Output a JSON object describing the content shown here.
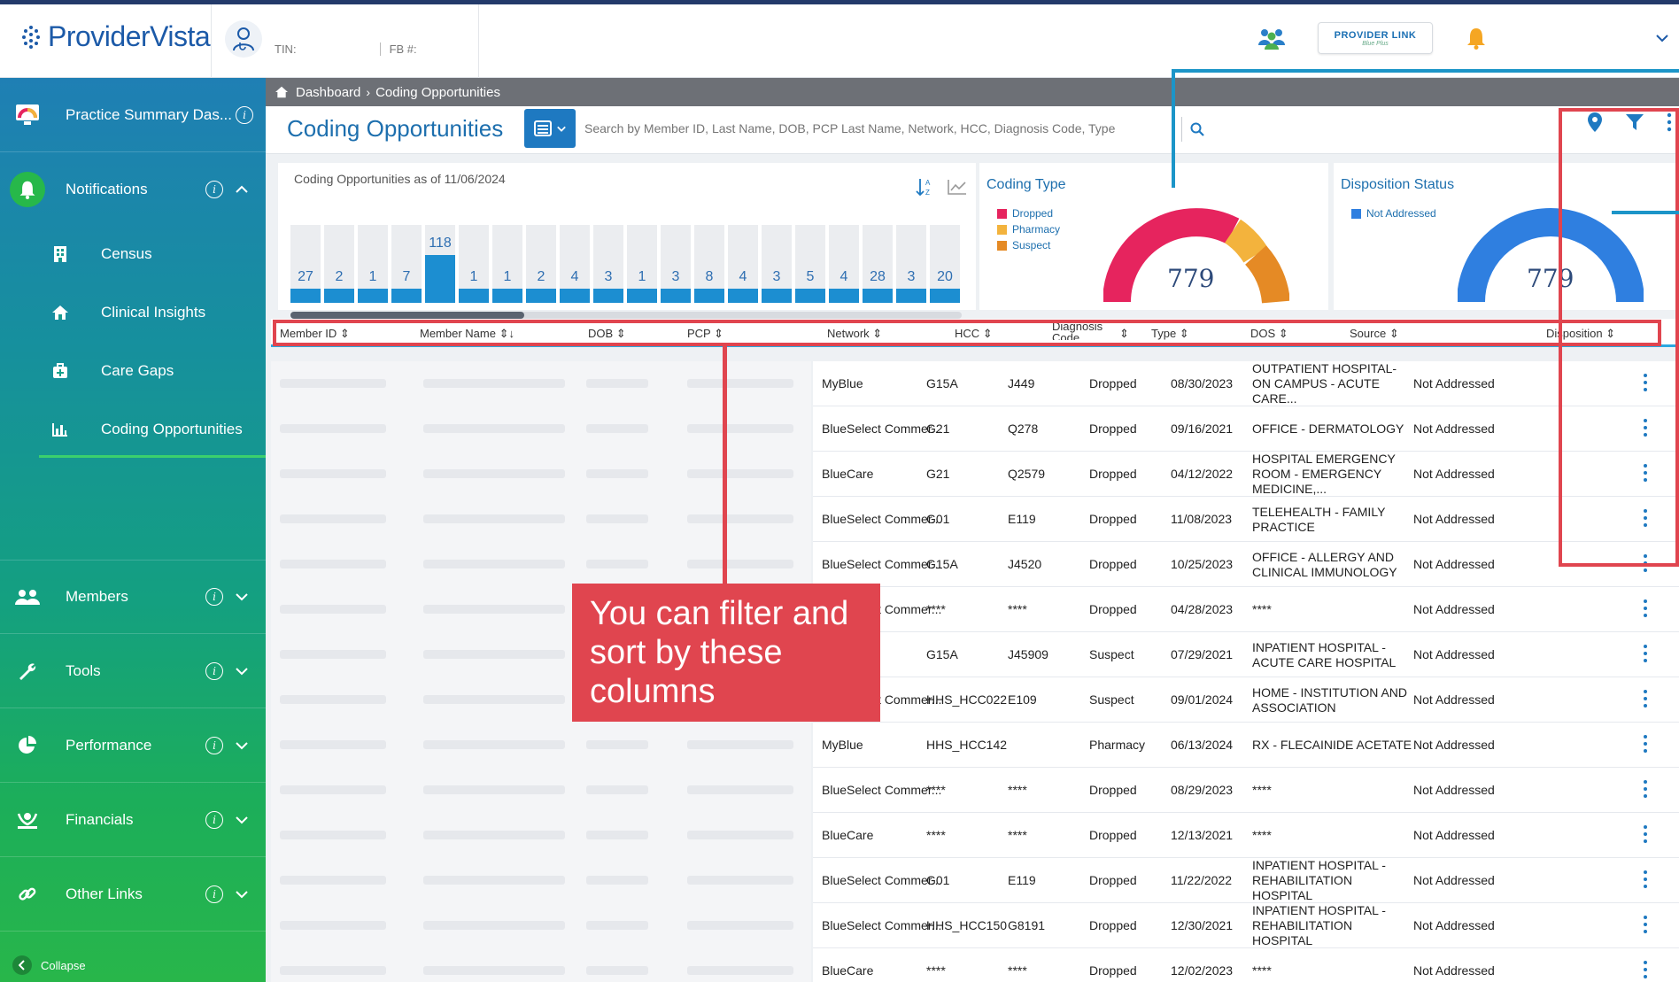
{
  "app": {
    "logo_text": "ProviderVista",
    "tin_label": "TIN:",
    "fb_label": "FB #:",
    "provider_link_label": "PROVIDER LINK",
    "provider_link_sub": "Blue Plus"
  },
  "sidebar": {
    "items": [
      {
        "label": "Practice Summary Das...",
        "icon": "dashboard-icon"
      },
      {
        "label": "Notifications",
        "icon": "bell-icon"
      },
      {
        "label": "Members",
        "icon": "members-icon"
      },
      {
        "label": "Tools",
        "icon": "wrench-icon"
      },
      {
        "label": "Performance",
        "icon": "pie-chart-icon"
      },
      {
        "label": "Financials",
        "icon": "financials-icon"
      },
      {
        "label": "Other Links",
        "icon": "link-icon"
      }
    ],
    "subitems": [
      {
        "label": "Census",
        "icon": "building-icon"
      },
      {
        "label": "Clinical Insights",
        "icon": "home-icon"
      },
      {
        "label": "Care Gaps",
        "icon": "medkit-icon"
      },
      {
        "label": "Coding Opportunities",
        "icon": "bar-chart-icon"
      }
    ],
    "collapse_label": "Collapse"
  },
  "breadcrumb": {
    "home": "Dashboard",
    "current": "Coding Opportunities"
  },
  "page": {
    "title": "Coding Opportunities",
    "search_placeholder": "Search by Member ID, Last Name, DOB, PCP Last Name, Network, HCC, Diagnosis Code, Type"
  },
  "trend": {
    "as_of": "Coding Opportunities as of 11/06/2024",
    "values": [
      27,
      2,
      1,
      7,
      118,
      1,
      1,
      2,
      4,
      3,
      1,
      3,
      8,
      4,
      3,
      5,
      4,
      28,
      3,
      20
    ],
    "highlight_index": 4
  },
  "coding_type": {
    "title": "Coding Type",
    "legend": [
      {
        "label": "Dropped",
        "color": "#e6245e"
      },
      {
        "label": "Pharmacy",
        "color": "#f3b33d"
      },
      {
        "label": "Suspect",
        "color": "#e58a25"
      }
    ],
    "total": "779"
  },
  "disposition": {
    "title": "Disposition Status",
    "legend": [
      {
        "label": "Not Addressed",
        "color": "#2f7fe0"
      }
    ],
    "total": "779"
  },
  "table": {
    "headers": [
      "Member ID",
      "Member Name",
      "DOB",
      "PCP",
      "Network",
      "HCC",
      "Diagnosis Code",
      "Type",
      "DOS",
      "Source",
      "Disposition"
    ],
    "rows": [
      {
        "network": "MyBlue",
        "hcc": "G15A",
        "dx": "J449",
        "type": "Dropped",
        "dos": "08/30/2023",
        "source": "OUTPATIENT HOSPITAL-ON CAMPUS - ACUTE CARE...",
        "disposition": "Not Addressed"
      },
      {
        "network": "BlueSelect Commer...",
        "hcc": "G21",
        "dx": "Q278",
        "type": "Dropped",
        "dos": "09/16/2021",
        "source": "OFFICE - DERMATOLOGY",
        "disposition": "Not Addressed"
      },
      {
        "network": "BlueCare",
        "hcc": "G21",
        "dx": "Q2579",
        "type": "Dropped",
        "dos": "04/12/2022",
        "source": "HOSPITAL EMERGENCY ROOM - EMERGENCY MEDICINE,...",
        "disposition": "Not Addressed"
      },
      {
        "network": "BlueSelect Commer...",
        "hcc": "G01",
        "dx": "E119",
        "type": "Dropped",
        "dos": "11/08/2023",
        "source": "TELEHEALTH - FAMILY PRACTICE",
        "disposition": "Not Addressed"
      },
      {
        "network": "BlueSelect Commer...",
        "hcc": "G15A",
        "dx": "J4520",
        "type": "Dropped",
        "dos": "10/25/2023",
        "source": "OFFICE - ALLERGY AND CLINICAL IMMUNOLOGY",
        "disposition": "Not Addressed"
      },
      {
        "network": "BlueSelect Commer...",
        "hcc": "****",
        "dx": "****",
        "type": "Dropped",
        "dos": "04/28/2023",
        "source": "****",
        "disposition": "Not Addressed"
      },
      {
        "network": "",
        "hcc": "G15A",
        "dx": "J45909",
        "type": "Suspect",
        "dos": "07/29/2021",
        "source": "INPATIENT HOSPITAL - ACUTE CARE HOSPITAL",
        "disposition": "Not Addressed"
      },
      {
        "network": "BlueSelect Commer...",
        "hcc": "HHS_HCC022",
        "dx": "E109",
        "type": "Suspect",
        "dos": "09/01/2024",
        "source": "HOME - INSTITUTION AND ASSOCIATION",
        "disposition": "Not Addressed"
      },
      {
        "network": "MyBlue",
        "hcc": "HHS_HCC142",
        "dx": "",
        "type": "Pharmacy",
        "dos": "06/13/2024",
        "source": "RX - FLECAINIDE ACETATE",
        "disposition": "Not Addressed"
      },
      {
        "network": "BlueSelect Commer...",
        "hcc": "****",
        "dx": "****",
        "type": "Dropped",
        "dos": "08/29/2023",
        "source": "****",
        "disposition": "Not Addressed"
      },
      {
        "network": "BlueCare",
        "hcc": "****",
        "dx": "****",
        "type": "Dropped",
        "dos": "12/13/2021",
        "source": "****",
        "disposition": "Not Addressed"
      },
      {
        "network": "BlueSelect Commer...",
        "hcc": "G01",
        "dx": "E119",
        "type": "Dropped",
        "dos": "11/22/2022",
        "source": "INPATIENT HOSPITAL - REHABILITATION HOSPITAL",
        "disposition": "Not Addressed"
      },
      {
        "network": "BlueSelect Commer...",
        "hcc": "HHS_HCC150",
        "dx": "G8191",
        "type": "Dropped",
        "dos": "12/30/2021",
        "source": "INPATIENT HOSPITAL - REHABILITATION HOSPITAL",
        "disposition": "Not Addressed"
      },
      {
        "network": "BlueCare",
        "hcc": "****",
        "dx": "****",
        "type": "Dropped",
        "dos": "12/02/2023",
        "source": "****",
        "disposition": "Not Addressed"
      }
    ]
  },
  "callout": {
    "text": "You can filter and sort by these columns",
    "color": "#e0454f"
  }
}
